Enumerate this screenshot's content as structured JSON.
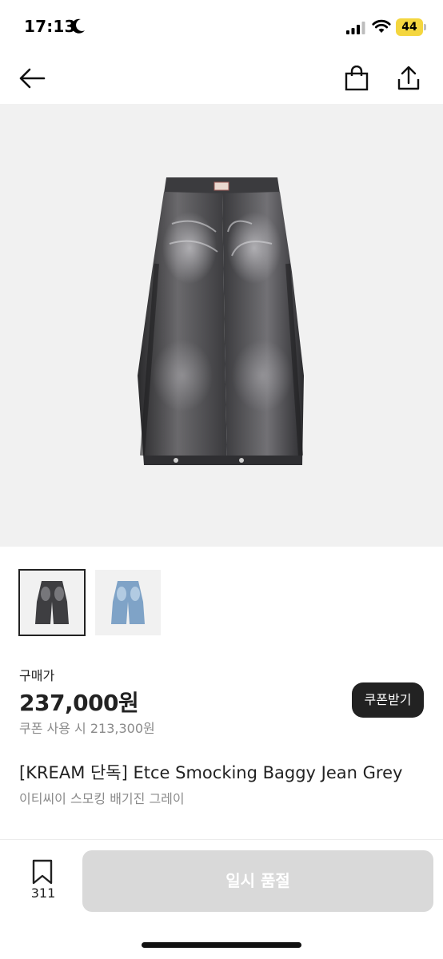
{
  "status_bar": {
    "time": "17:13",
    "battery": "44",
    "icons": [
      "moon-icon",
      "signal-icon",
      "wifi-icon",
      "battery-icon"
    ]
  },
  "nav": {
    "icons": [
      "back-arrow-icon",
      "shopping-bag-icon",
      "share-icon"
    ]
  },
  "thumbnails": [
    {
      "variant": "grey",
      "selected": true
    },
    {
      "variant": "light-blue",
      "selected": false
    }
  ],
  "price": {
    "label": "구매가",
    "value": "237,000원",
    "coupon_price": "쿠폰 사용 시 213,300원",
    "coupon_button": "쿠폰받기"
  },
  "product": {
    "title": "[KREAM 단독] Etce Smocking Baggy Jean Grey",
    "subtitle": "이티씨이 스모킹 배기진 그레이"
  },
  "bottom": {
    "wish_count": "311",
    "soldout_label": "일시 품절"
  },
  "colors": {
    "accent_dark": "#222222",
    "muted_text": "#8a8a8a",
    "disabled_button": "#d9d9d9",
    "image_background": "#f1f1f1",
    "battery_yellow": "#f4d63f"
  }
}
